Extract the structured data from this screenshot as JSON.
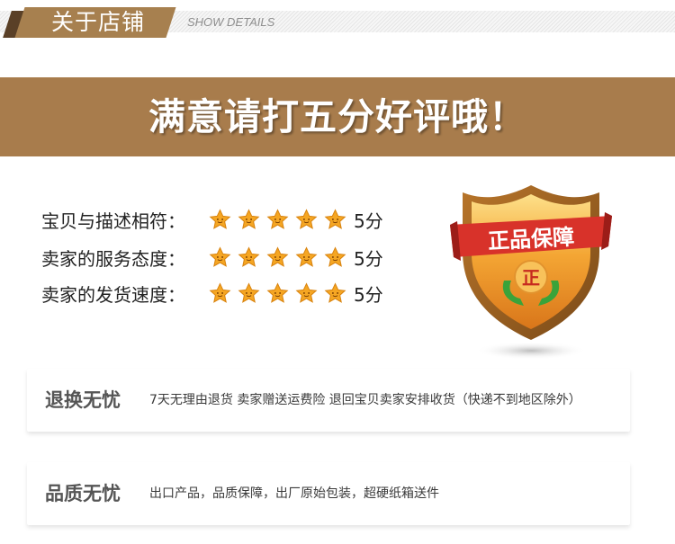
{
  "header": {
    "title": "关于店铺",
    "subtitle": "SHOW DETAILS"
  },
  "banner": {
    "text": "满意请打五分好评哦！"
  },
  "ratings": [
    {
      "label": "宝贝与描述相符：",
      "stars": 5,
      "score": "5分"
    },
    {
      "label": "卖家的服务态度：",
      "stars": 5,
      "score": "5分"
    },
    {
      "label": "卖家的发货速度：",
      "stars": 5,
      "score": "5分"
    }
  ],
  "badge": {
    "ribbon_text": "正品保障",
    "emblem_char": "正"
  },
  "guarantees": [
    {
      "title": "退换无忧",
      "text": "7天无理由退货 卖家赠送运费险 退回宝贝卖家安排收货（快递不到地区除外）"
    },
    {
      "title": "品质无忧",
      "text": "出口产品，品质保障，出厂原始包装，超硬纸箱送件"
    }
  ],
  "colors": {
    "brand_brown": "#a87c4c",
    "dark_brown": "#5a4027",
    "star_gold": "#f5a623",
    "ribbon_red": "#d8322a",
    "shield_orange": "#e9811f",
    "hands_green": "#3aa33a"
  }
}
